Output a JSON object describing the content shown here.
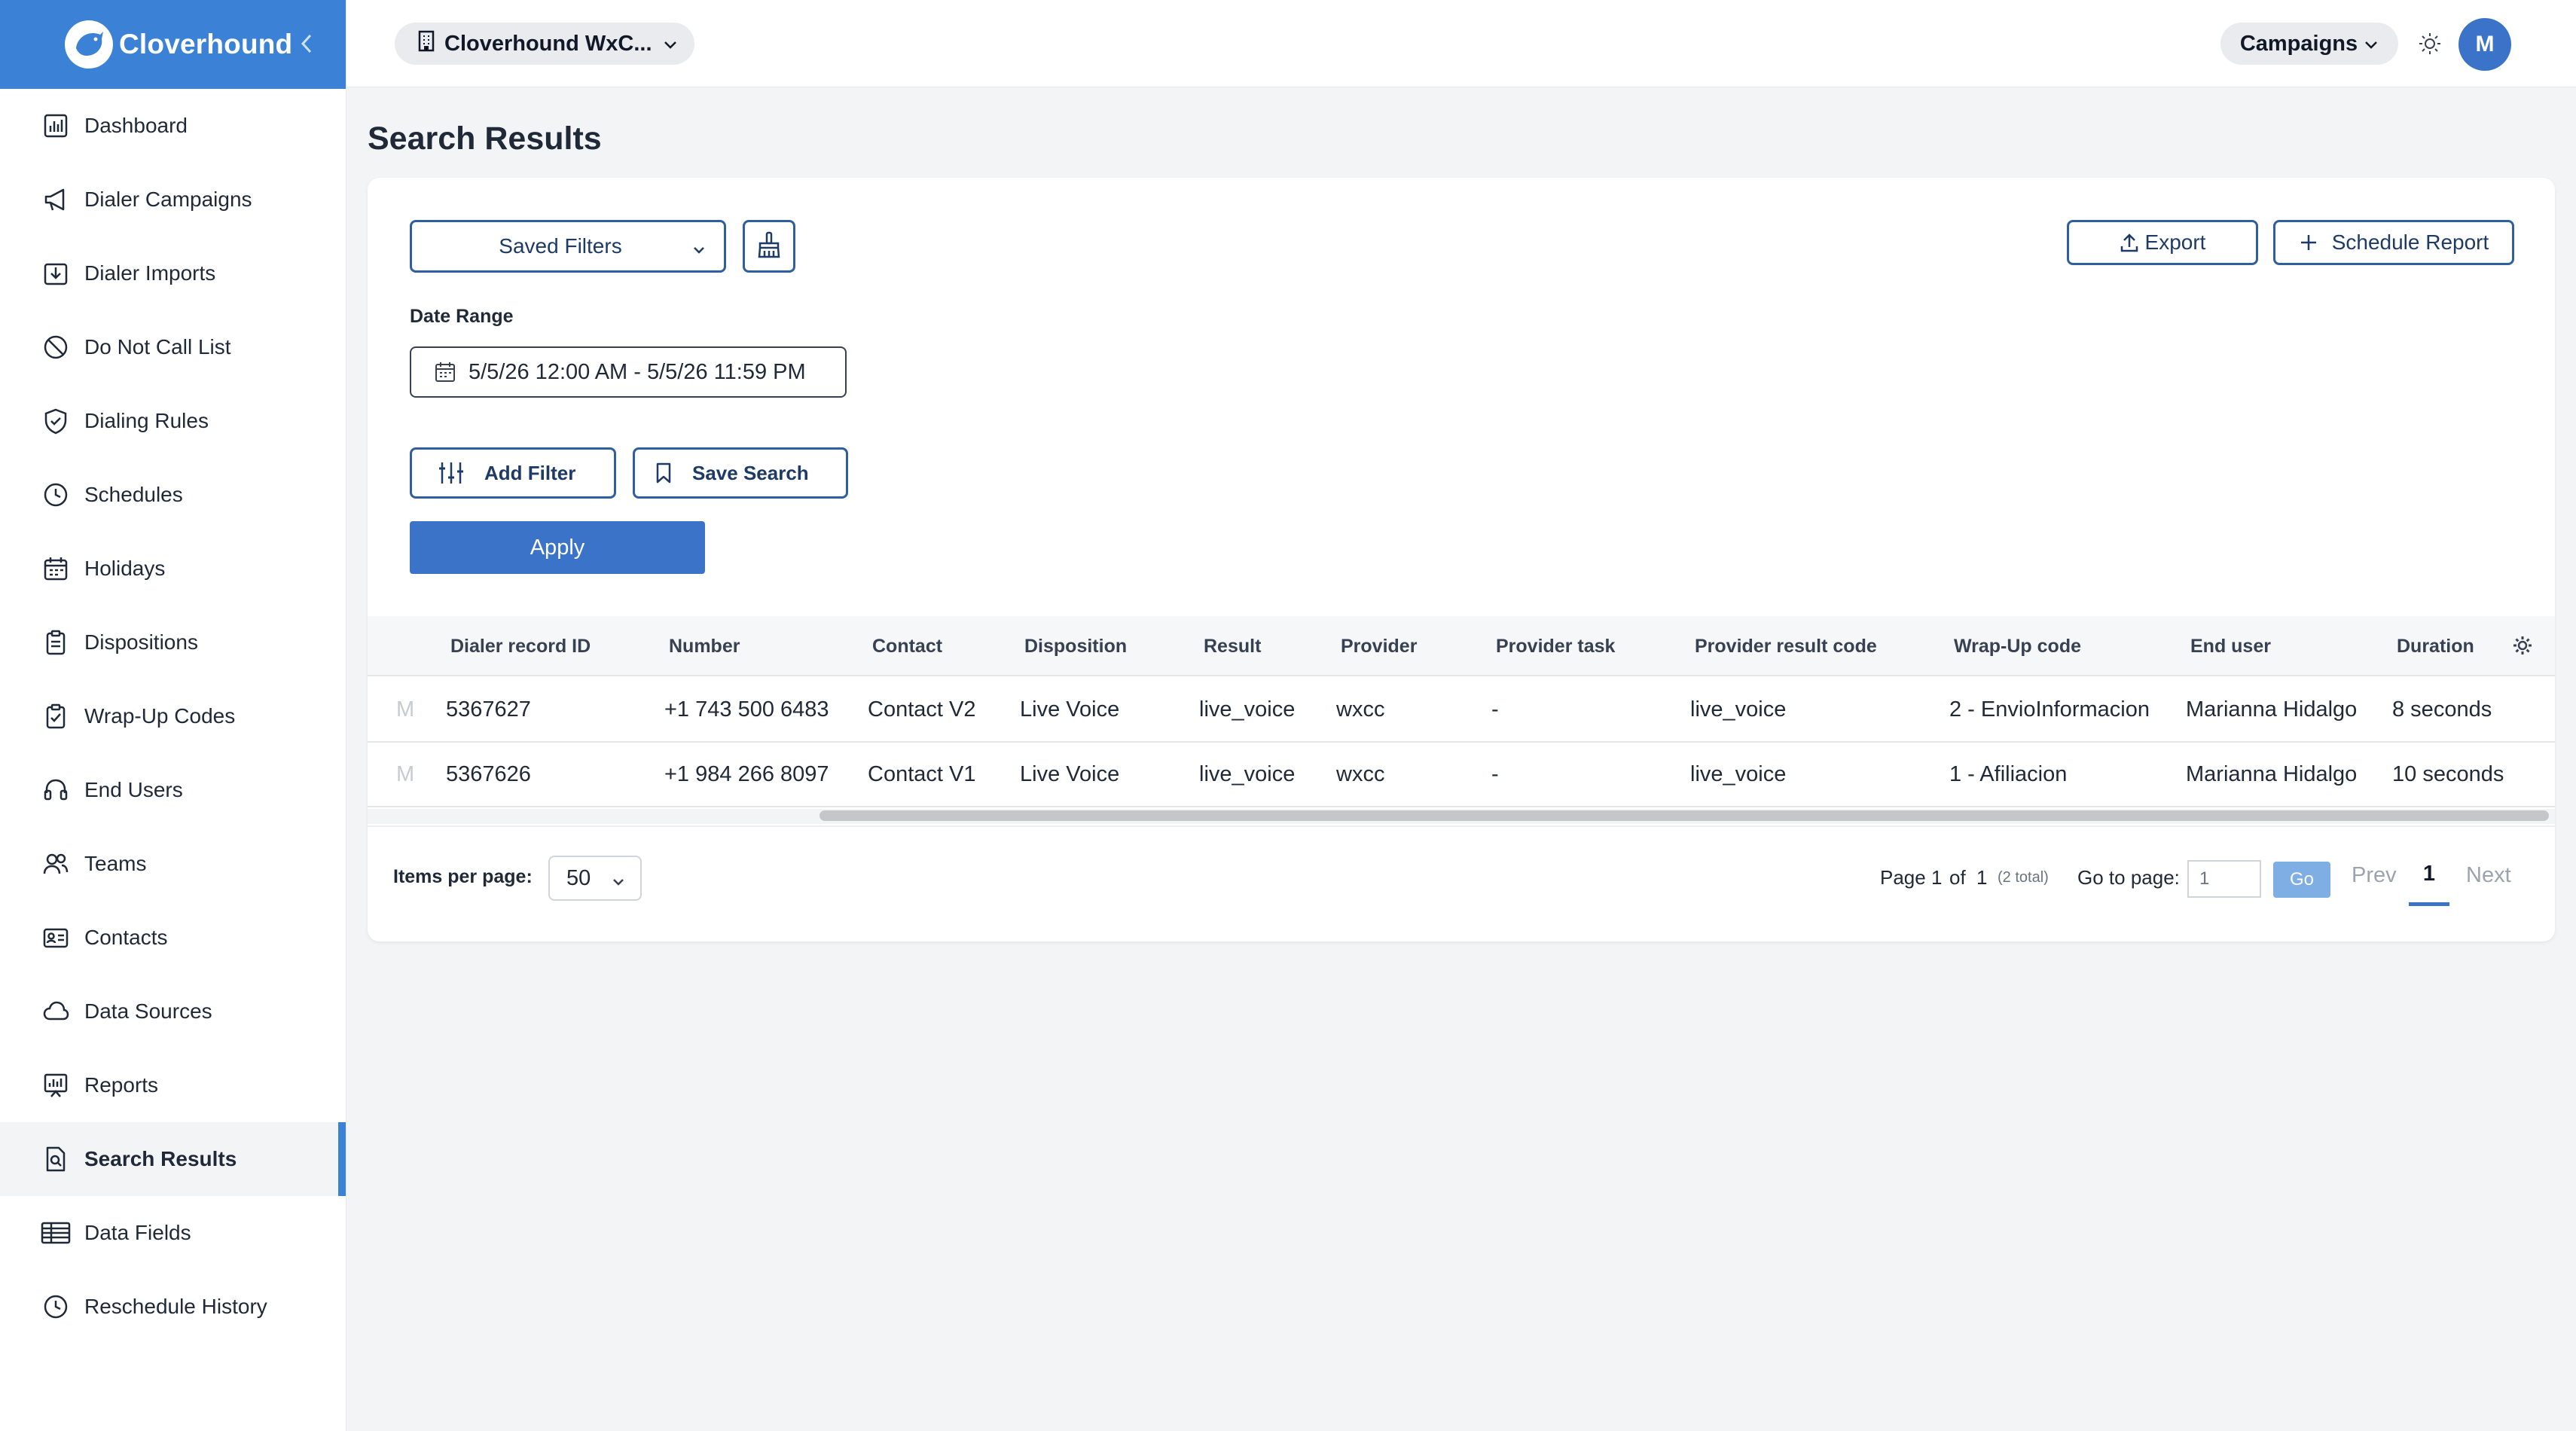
{
  "brand": {
    "name": "Cloverhound"
  },
  "header": {
    "org_name": "Cloverhound WxC...",
    "campaigns_label": "Campaigns",
    "avatar_initial": "M"
  },
  "sidebar": {
    "items": [
      {
        "label": "Dashboard",
        "icon": "chart-icon"
      },
      {
        "label": "Dialer Campaigns",
        "icon": "megaphone-icon"
      },
      {
        "label": "Dialer Imports",
        "icon": "import-icon"
      },
      {
        "label": "Do Not Call List",
        "icon": "ban-icon"
      },
      {
        "label": "Dialing Rules",
        "icon": "shield-icon"
      },
      {
        "label": "Schedules",
        "icon": "clock-icon"
      },
      {
        "label": "Holidays",
        "icon": "calendar-icon"
      },
      {
        "label": "Dispositions",
        "icon": "clipboard-icon"
      },
      {
        "label": "Wrap-Up Codes",
        "icon": "clipboard-check-icon"
      },
      {
        "label": "End Users",
        "icon": "headset-icon"
      },
      {
        "label": "Teams",
        "icon": "users-icon"
      },
      {
        "label": "Contacts",
        "icon": "contact-card-icon"
      },
      {
        "label": "Data Sources",
        "icon": "cloud-icon"
      },
      {
        "label": "Reports",
        "icon": "report-icon"
      },
      {
        "label": "Search Results",
        "icon": "search-document-icon",
        "active": true
      },
      {
        "label": "Data Fields",
        "icon": "table-icon"
      },
      {
        "label": "Reschedule History",
        "icon": "history-icon"
      }
    ]
  },
  "main": {
    "title": "Search Results",
    "saved_filters_label": "Saved Filters",
    "export_label": "Export",
    "schedule_report_label": "Schedule Report",
    "date_range_label": "Date Range",
    "date_range_value": "5/5/26 12:00 AM - 5/5/26 11:59 PM",
    "add_filter_label": "Add Filter",
    "save_search_label": "Save Search",
    "apply_label": "Apply"
  },
  "table": {
    "headers": [
      "Dialer record ID",
      "Number",
      "Contact",
      "Disposition",
      "Result",
      "Provider",
      "Provider task",
      "Provider result code",
      "Wrap-Up code",
      "End user",
      "Duration"
    ],
    "rows": [
      {
        "lead": "M",
        "cells": [
          "5367627",
          "+1 743 500 6483",
          "Contact V2",
          "Live Voice",
          "live_voice",
          "wxcc",
          "-",
          "live_voice",
          "2 - EnvioInformacion",
          "Marianna Hidalgo",
          "8 seconds"
        ]
      },
      {
        "lead": "M",
        "cells": [
          "5367626",
          "+1 984 266 8097",
          "Contact V1",
          "Live Voice",
          "live_voice",
          "wxcc",
          "-",
          "live_voice",
          "1 - Afiliacion",
          "Marianna Hidalgo",
          "10 seconds"
        ]
      }
    ]
  },
  "pagination": {
    "items_per_page_label": "Items per page:",
    "items_per_page_value": "50",
    "page_label": "Page 1",
    "of_label": "of",
    "total_pages": "1",
    "total_items": "(2 total)",
    "goto_label": "Go to page:",
    "goto_value": "1",
    "go_label": "Go",
    "prev_label": "Prev",
    "current_page": "1",
    "next_label": "Next"
  },
  "colors": {
    "accent": "#3b82d6",
    "primary_button": "#3b73c8",
    "outline_border": "#2f5f9e"
  }
}
